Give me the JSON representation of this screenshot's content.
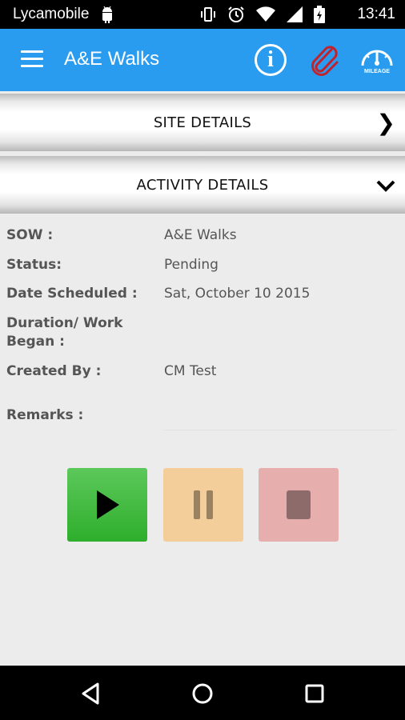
{
  "status_bar": {
    "carrier": "Lycamobile",
    "time": "13:41"
  },
  "app_bar": {
    "title": "A&E Walks",
    "info_glyph": "i",
    "mileage_text": "MILEAGE"
  },
  "sections": {
    "site_details": "SITE DETAILS",
    "activity_details": "ACTIVITY DETAILS"
  },
  "details": {
    "sow_label": "SOW :",
    "sow_value": "A&E Walks",
    "status_label": "Status:",
    "status_value": "Pending",
    "date_label": "Date Scheduled :",
    "date_value": "Sat, October 10 2015",
    "duration_label": "Duration/ Work Began :",
    "created_label": "Created By :",
    "created_value": "CM Test",
    "remarks_label": "Remarks :",
    "remarks_value": ""
  },
  "colors": {
    "app_bar": "#2a9cf0",
    "play": "#2eae2c",
    "pause": "#f3cd9a",
    "stop": "#e7aeae",
    "attachment_icon": "#c0232e"
  },
  "icons": [
    "android-icon",
    "vibrate-icon",
    "alarm-icon",
    "wifi-icon",
    "signal-icon",
    "battery-icon",
    "hamburger-menu-icon",
    "info-icon",
    "paperclip-icon",
    "mileage-gauge-icon",
    "play-icon",
    "pause-icon",
    "stop-icon",
    "back-icon",
    "home-icon",
    "recents-icon"
  ]
}
